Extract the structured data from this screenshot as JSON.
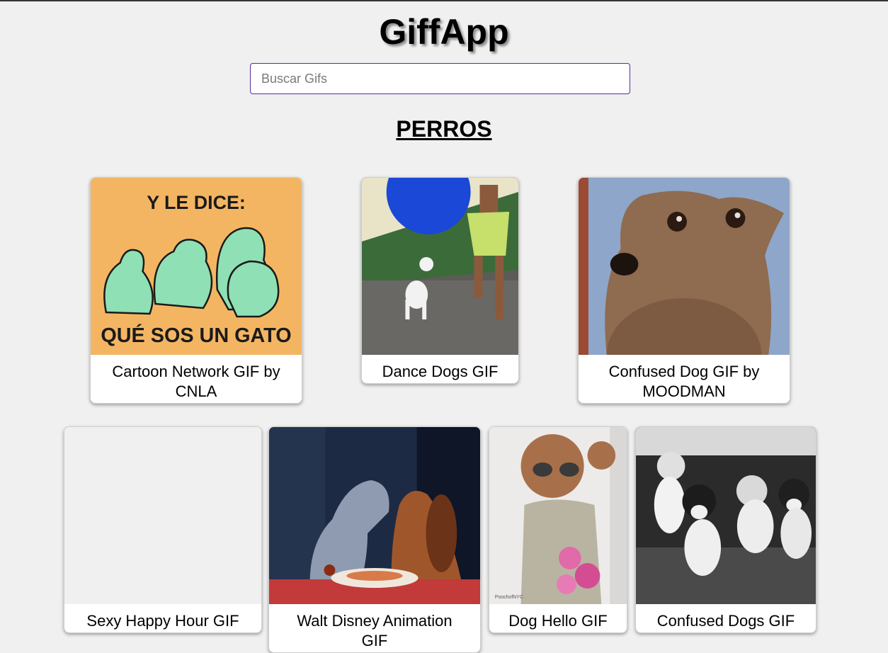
{
  "app": {
    "title": "GiffApp"
  },
  "search": {
    "placeholder": "Buscar Gifs",
    "value": ""
  },
  "category": {
    "title": "PERROS"
  },
  "gifs": [
    {
      "title": "Cartoon Network GIF by CNLA",
      "image_text_top": "Y LE DICE:",
      "image_text_bottom": "QUÉ SOS UN GATO"
    },
    {
      "title": "Dance Dogs GIF"
    },
    {
      "title": "Confused Dog GIF by MOODMAN"
    },
    {
      "title": "Sexy Happy Hour GIF"
    },
    {
      "title": "Walt Disney Animation GIF"
    },
    {
      "title": "Dog Hello GIF",
      "image_text_corner": "PoochofNYC"
    },
    {
      "title": "Confused Dogs GIF"
    }
  ],
  "colors": {
    "background": "#f0f0f0",
    "search_border": "#5b2aa3",
    "card_bg": "#ffffff"
  }
}
